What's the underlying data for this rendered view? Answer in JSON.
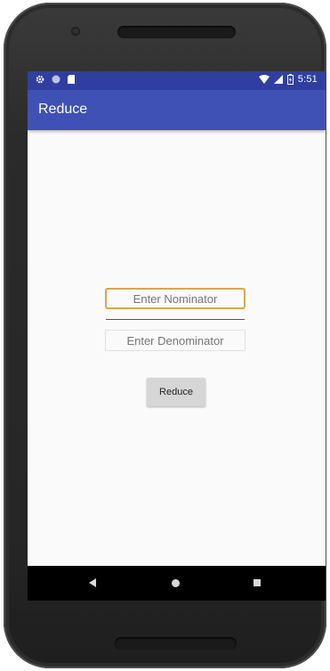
{
  "status_bar": {
    "time": "5:51",
    "icons": [
      "gear-icon",
      "circle-icon",
      "sd-card-icon",
      "wifi-icon",
      "signal-icon",
      "battery-icon"
    ]
  },
  "app_bar": {
    "title": "Reduce"
  },
  "form": {
    "nominator_placeholder": "Enter Nominator",
    "denominator_placeholder": "Enter Denominator",
    "reduce_button_label": "Reduce"
  },
  "nav_bar": {
    "icons": [
      "back-icon",
      "home-icon",
      "recents-icon"
    ]
  },
  "colors": {
    "status_bar": "#303f9f",
    "app_bar": "#3f51b5",
    "focus_border": "#d8a84a",
    "button": "#d6d6d6"
  }
}
